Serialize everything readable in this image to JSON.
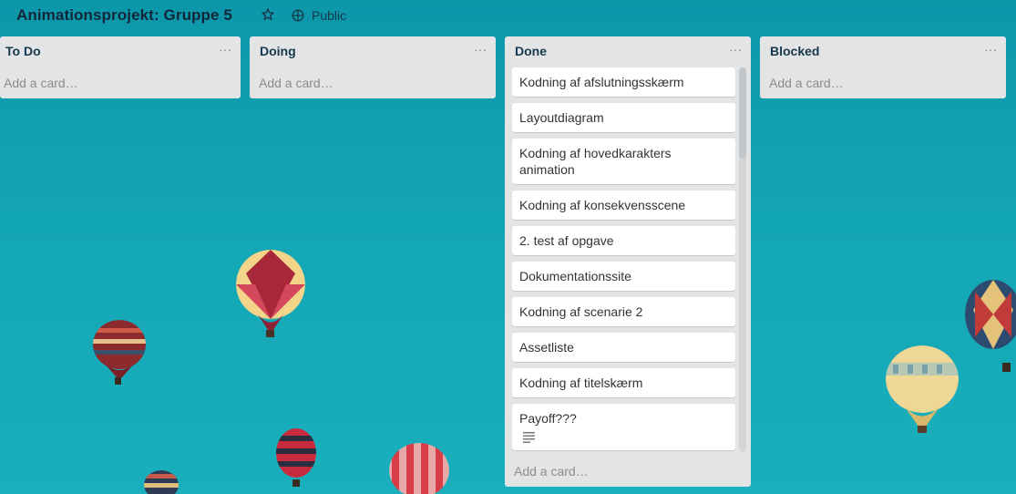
{
  "board": {
    "title": "Animationsprojekt: Gruppe 5",
    "visibility": "Public",
    "star_icon": "star-icon",
    "visibility_icon": "globe-icon"
  },
  "lists": [
    {
      "title": "To Do",
      "menu": "···",
      "add_card": "Add a card…",
      "cards": []
    },
    {
      "title": "Doing",
      "menu": "···",
      "add_card": "Add a card…",
      "cards": []
    },
    {
      "title": "Done",
      "menu": "···",
      "add_card": "Add a card…",
      "cards": [
        "Kodning af afslutningsskærm",
        "Layoutdiagram",
        "Kodning af hovedkarakters animation",
        "Kodning af konsekvensscene",
        "2. test af opgave",
        "Dokumentationssite",
        "Kodning af scenarie 2",
        "Assetliste",
        "Kodning af titelskærm",
        "Payoff???"
      ]
    },
    {
      "title": "Blocked",
      "menu": "···",
      "add_card": "Add a card…",
      "cards": []
    }
  ],
  "colors": {
    "background": "#13a6b5",
    "list_bg": "#e2e4e6",
    "card_bg": "#ffffff",
    "title_text": "#12263a"
  }
}
